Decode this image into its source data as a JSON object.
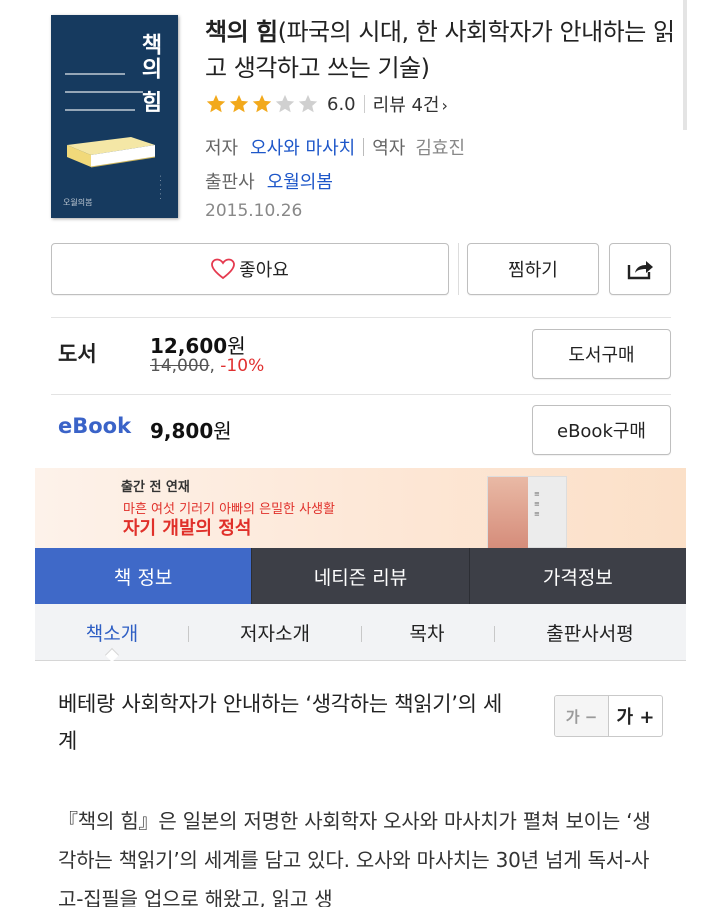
{
  "book": {
    "cover_title": "책의 힘",
    "cover_publisher": "오월의봄",
    "title_main": "책의 힘",
    "title_sub": "(파국의 시대, 한 사회학자가 안내하는 읽고 생각하고 쓰는 기술)",
    "rating_value": 6.0,
    "rating_stars": 3,
    "rating_max": 5,
    "rating_label": "6.0",
    "review_label": "리뷰 4건",
    "review_chevron": "›",
    "author_label": "저자",
    "author": "오사와 마사치",
    "translator_label": "역자",
    "translator": "김효진",
    "publisher_label": "출판사",
    "publisher": "오월의봄",
    "date": "2015.10.26"
  },
  "actions": {
    "like_label": "좋아요",
    "wishlist_label": "찜하기"
  },
  "prices": {
    "book_label": "도서",
    "book_price_num": "12,600",
    "book_price_unit": "원",
    "book_original": "14,000",
    "book_discount": "-10%",
    "book_buy": "도서구매",
    "ebook_label": "eBook",
    "ebook_price_num": "9,800",
    "ebook_price_unit": "원",
    "ebook_buy": "eBook구매"
  },
  "banner": {
    "tag": "출간 전 연재",
    "line1": "마흔 여섯 기러기 아빠의 은밀한 사생활",
    "line2": "자기 개발의 정석"
  },
  "tabs": [
    "책 정보",
    "네티즌 리뷰",
    "가격정보"
  ],
  "subtabs": [
    "책소개",
    "저자소개",
    "목차",
    "출판사서평"
  ],
  "font_controls": {
    "decrease": "가 −",
    "increase": "가 +"
  },
  "content": {
    "heading": "베테랑 사회학자가 안내하는 ‘생각하는 책읽기’의 세계",
    "body": "『책의 힘』은 일본의 저명한 사회학자 오사와 마사치가 펼쳐 보이는 ‘생각하는 책읽기’의 세계를 담고 있다. 오사와 마사치는 30년 넘게 독서-사고-집필을 업으로 해왔고, 읽고 생"
  },
  "colors": {
    "accent": "#3f69c8",
    "link": "#1e57c9",
    "star": "#f2a91c",
    "discount": "#e03030",
    "tab_dark": "#3d3f47",
    "cover": "#163a5f"
  }
}
